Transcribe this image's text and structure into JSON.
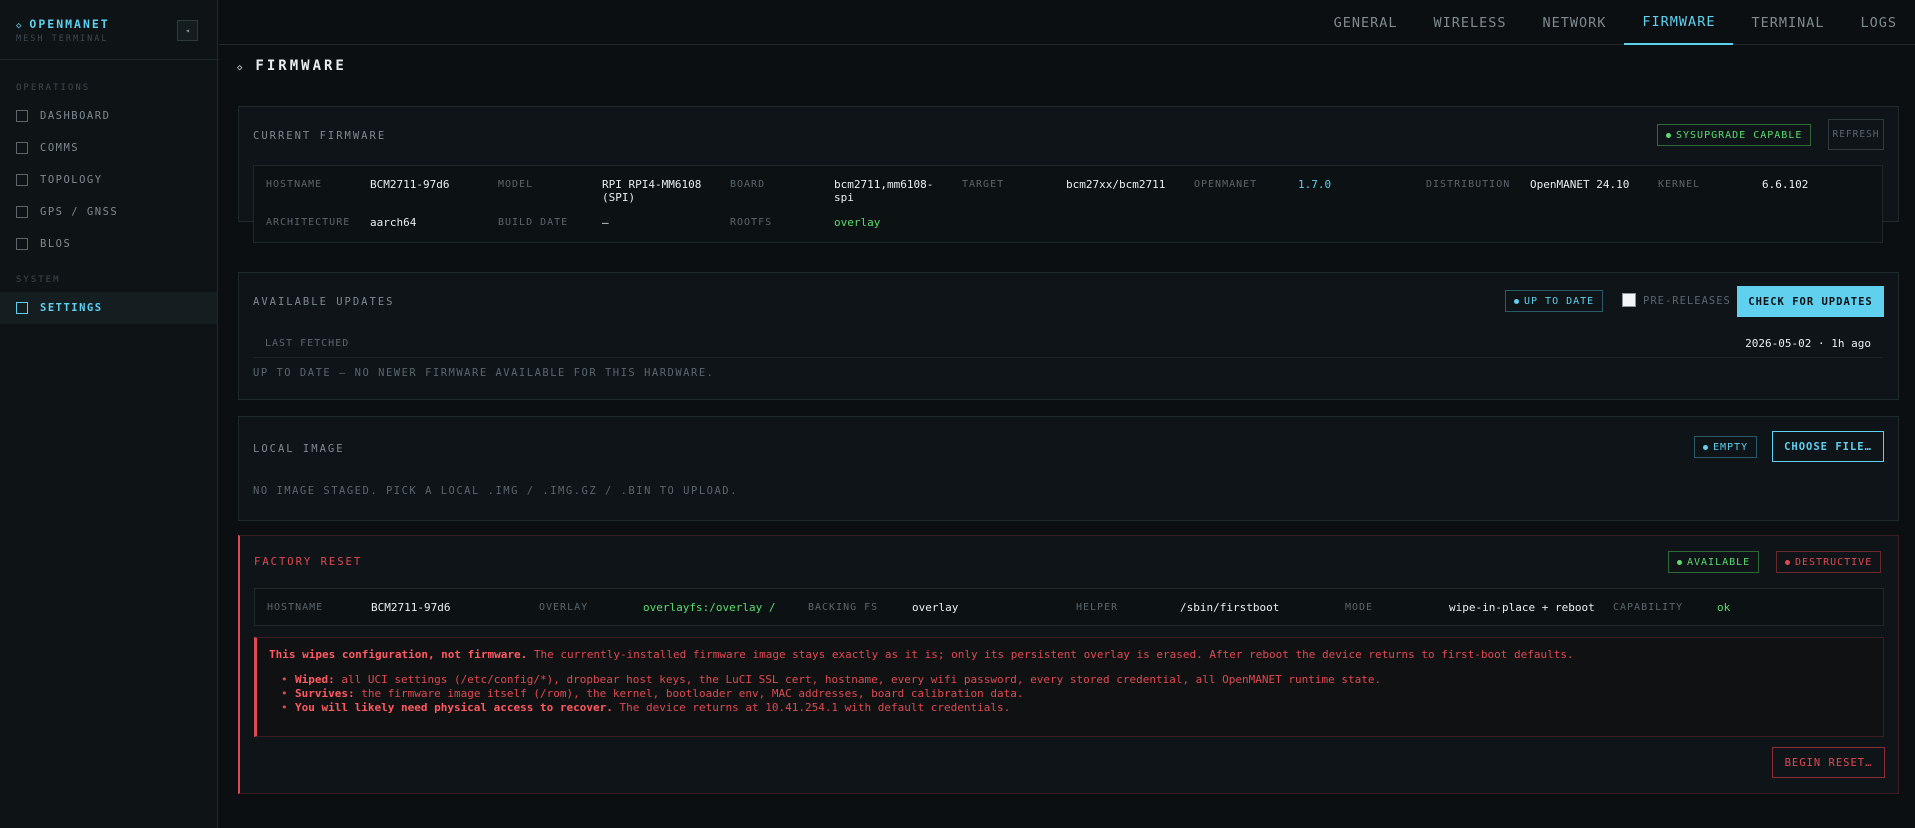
{
  "sidebar": {
    "brand_title": "OPENMANET",
    "brand_subtitle": "MESH TERMINAL",
    "collapse_icon": "◂",
    "sections": [
      {
        "label": "OPERATIONS",
        "items": [
          {
            "label": "DASHBOARD"
          },
          {
            "label": "COMMS"
          },
          {
            "label": "TOPOLOGY"
          },
          {
            "label": "GPS / GNSS"
          },
          {
            "label": "BLOS"
          }
        ]
      },
      {
        "label": "SYSTEM",
        "items": [
          {
            "label": "SETTINGS",
            "active": true
          }
        ]
      }
    ]
  },
  "tabs": [
    {
      "label": "GENERAL"
    },
    {
      "label": "WIRELESS"
    },
    {
      "label": "NETWORK"
    },
    {
      "label": "FIRMWARE",
      "active": true
    },
    {
      "label": "TERMINAL"
    },
    {
      "label": "LOGS"
    }
  ],
  "page_title": "FIRMWARE",
  "current_firmware": {
    "title": "CURRENT FIRMWARE",
    "badge": "SYSUPGRADE CAPABLE",
    "refresh_label": "REFRESH",
    "fields": {
      "hostname": {
        "label": "HOSTNAME",
        "value": "BCM2711-97d6"
      },
      "model": {
        "label": "MODEL",
        "value": "RPI RPI4-MM6108 (SPI)"
      },
      "board": {
        "label": "BOARD",
        "value": "bcm2711,mm6108-spi"
      },
      "target": {
        "label": "TARGET",
        "value": "bcm27xx/bcm2711"
      },
      "openmanet": {
        "label": "OPENMANET",
        "value": "1.7.0"
      },
      "distribution": {
        "label": "DISTRIBUTION",
        "value": "OpenMANET 24.10"
      },
      "kernel": {
        "label": "KERNEL",
        "value": "6.6.102"
      },
      "architecture": {
        "label": "ARCHITECTURE",
        "value": "aarch64"
      },
      "build_date": {
        "label": "BUILD DATE",
        "value": "—"
      },
      "rootfs": {
        "label": "ROOTFS",
        "value": "overlay"
      }
    }
  },
  "available_updates": {
    "title": "AVAILABLE UPDATES",
    "badge": "UP TO DATE",
    "prereleases_label": "PRE-RELEASES",
    "prereleases_checked": false,
    "check_label": "CHECK FOR UPDATES",
    "last_fetched_label": "LAST FETCHED",
    "last_fetched_value": "2026-05-02 · 1h ago",
    "message": "UP TO DATE — NO NEWER FIRMWARE AVAILABLE FOR THIS HARDWARE."
  },
  "local_image": {
    "title": "LOCAL IMAGE",
    "badge": "EMPTY",
    "choose_label": "CHOOSE FILE…",
    "message": "NO IMAGE STAGED. PICK A LOCAL .IMG / .IMG.GZ / .BIN TO UPLOAD."
  },
  "factory_reset": {
    "title": "FACTORY RESET",
    "badge_available": "AVAILABLE",
    "badge_destructive": "DESTRUCTIVE",
    "fields": {
      "hostname": {
        "label": "HOSTNAME",
        "value": "BCM2711-97d6"
      },
      "overlay": {
        "label": "OVERLAY",
        "value": "overlayfs:/overlay /"
      },
      "backing_fs": {
        "label": "BACKING FS",
        "value": "overlay"
      },
      "helper": {
        "label": "HELPER",
        "value": "/sbin/firstboot"
      },
      "mode": {
        "label": "MODE",
        "value": "wipe-in-place + reboot"
      },
      "capability": {
        "label": "CAPABILITY",
        "value": "ok"
      }
    },
    "warning": {
      "lead_bold": "This wipes configuration, not firmware.",
      "lead_rest": " The currently-installed firmware image stays exactly as it is; only its persistent overlay is erased. After reboot the device returns to first-boot defaults.",
      "items": [
        {
          "bold": "Wiped:",
          "text": " all UCI settings (/etc/config/*), dropbear host keys, the LuCI SSL cert, hostname, every wifi password, every stored credential, all OpenMANET runtime state."
        },
        {
          "bold": "Survives:",
          "text": " the firmware image itself (/rom), the kernel, bootloader env, MAC addresses, board calibration data."
        },
        {
          "bold": "You will likely need physical access to recover.",
          "text": " The device returns at 10.41.254.1 with default credentials."
        }
      ]
    },
    "begin_label": "BEGIN RESET…"
  },
  "colors": {
    "accent": "#5fd0ee",
    "ok": "#5ddc6e",
    "danger": "#e04a52",
    "background": "#0b0f12"
  }
}
